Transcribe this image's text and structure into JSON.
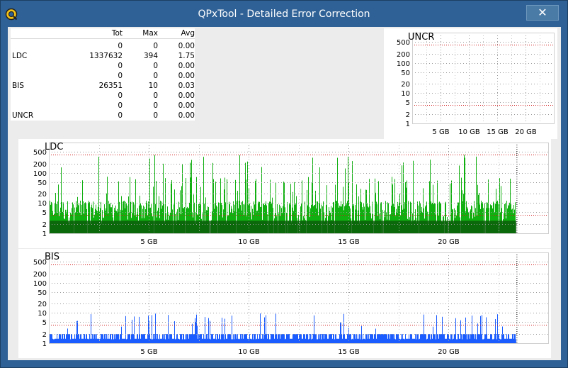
{
  "window": {
    "title": "QPxTool - Detailed Error Correction",
    "close_label": "✕",
    "app_icon": "qpxtool-logo-icon"
  },
  "stats": {
    "headers": {
      "tot": "Tot",
      "max": "Max",
      "avg": "Avg"
    },
    "rows": [
      {
        "name": "",
        "tot": "0",
        "max": "0",
        "avg": "0.00"
      },
      {
        "name": "LDC",
        "tot": "1337632",
        "max": "394",
        "avg": "1.75"
      },
      {
        "name": "",
        "tot": "0",
        "max": "0",
        "avg": "0.00"
      },
      {
        "name": "",
        "tot": "0",
        "max": "0",
        "avg": "0.00"
      },
      {
        "name": "BIS",
        "tot": "26351",
        "max": "10",
        "avg": "0.03"
      },
      {
        "name": "",
        "tot": "0",
        "max": "0",
        "avg": "0.00"
      },
      {
        "name": "",
        "tot": "0",
        "max": "0",
        "avg": "0.00"
      },
      {
        "name": "UNCR",
        "tot": "0",
        "max": "0",
        "avg": "0.00"
      }
    ]
  },
  "chart_data": [
    {
      "type": "bar",
      "title": "UNCR",
      "yscale": "log",
      "y_ticks": [
        "500",
        "200",
        "100",
        "50",
        "20",
        "10",
        "5",
        "2",
        "1"
      ],
      "x_ticks": [
        "5 GB",
        "10 GB",
        "15 GB",
        "20 GB"
      ],
      "x_unit": "GB",
      "xlim": [
        0,
        25
      ],
      "ylim": [
        1,
        1000
      ],
      "threshold_lines": [
        400,
        4
      ],
      "values": [],
      "color": "#ff0000",
      "grid": true
    },
    {
      "type": "bar",
      "title": "LDC",
      "yscale": "log",
      "y_ticks": [
        "500",
        "200",
        "100",
        "50",
        "20",
        "10",
        "5",
        "2",
        "1"
      ],
      "x_ticks": [
        "5 GB",
        "10 GB",
        "15 GB",
        "20 GB"
      ],
      "x_unit": "GB",
      "xlim": [
        0,
        25
      ],
      "ylim": [
        1,
        1000
      ],
      "data_extent_gb": 23.4,
      "max": 394,
      "typical": 10,
      "threshold_lines": [
        400,
        4
      ],
      "color": "#11b011",
      "dark_color": "#0a5d0a",
      "grid": true
    },
    {
      "type": "bar",
      "title": "BIS",
      "yscale": "log",
      "y_ticks": [
        "500",
        "200",
        "100",
        "50",
        "20",
        "10",
        "5",
        "2",
        "1"
      ],
      "x_ticks": [
        "5 GB",
        "10 GB",
        "15 GB",
        "20 GB"
      ],
      "x_unit": "GB",
      "xlim": [
        0,
        25
      ],
      "ylim": [
        1,
        1000
      ],
      "data_extent_gb": 23.4,
      "max": 10,
      "typical": 1,
      "threshold_lines": [
        400,
        4
      ],
      "color": "#1a5cff",
      "dark_color": "#0b2f99",
      "grid": true
    }
  ]
}
